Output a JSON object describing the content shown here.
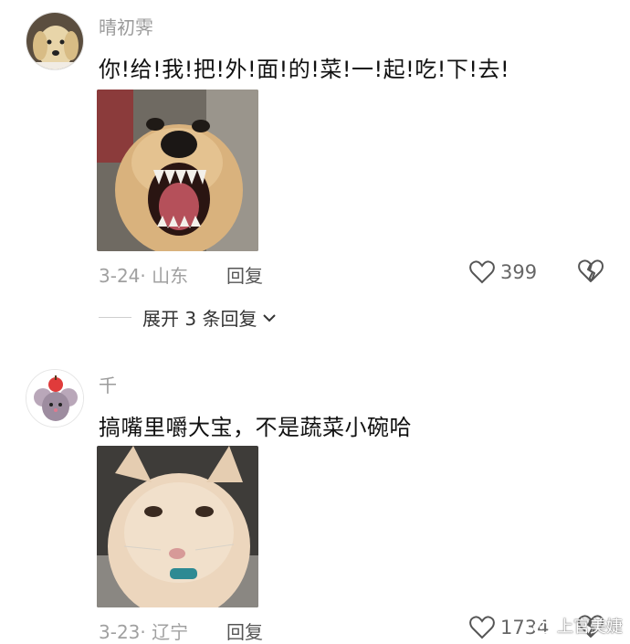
{
  "comments": [
    {
      "username": "晴初霁",
      "text": "你!给!我!把!外!面!的!菜!一!起!吃!下!去!",
      "date": "3-24·",
      "location": "山东",
      "reply_label": "回复",
      "likes": "399",
      "expand_label": "展开 3 条回复",
      "image_subject": "snarling-dog-photo",
      "avatar_subject": "golden-retriever-avatar"
    },
    {
      "username": "千",
      "text": "搞嘴里嚼大宝，不是蔬菜小碗哈",
      "date": "3-23·",
      "location": "辽宁",
      "reply_label": "回复",
      "likes": "1734",
      "image_subject": "cream-cat-photo",
      "avatar_subject": "mouse-with-apple-avatar"
    }
  ],
  "watermark": {
    "text": "上官美婕",
    "icon": "weibo-icon"
  },
  "colors": {
    "meta_gray": "#a0a0a0",
    "text": "#111111",
    "username": "#9a9a9a"
  }
}
